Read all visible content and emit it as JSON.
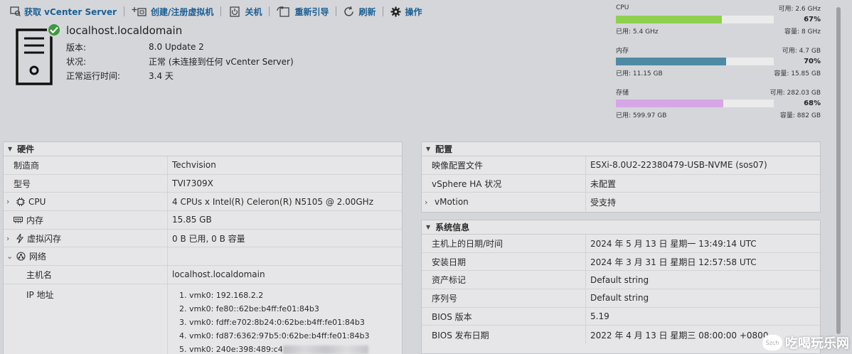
{
  "toolbar": {
    "items": [
      {
        "label": "获取 vCenter Server",
        "icon": "vcenter-icon"
      },
      {
        "label": "创建/注册虚拟机",
        "icon": "create-vm-icon"
      },
      {
        "label": "关机",
        "icon": "power-icon"
      },
      {
        "label": "重新引导",
        "icon": "reboot-icon"
      },
      {
        "label": "刷新",
        "icon": "refresh-icon"
      },
      {
        "label": "操作",
        "icon": "gear-icon"
      }
    ]
  },
  "host": {
    "name": "localhost.localdomain",
    "rows": [
      {
        "key": "版本:",
        "value": "8.0 Update 2"
      },
      {
        "key": "状况:",
        "value": "正常 (未连接到任何 vCenter Server)"
      },
      {
        "key": "正常运行时间:",
        "value": "3.4 天"
      }
    ]
  },
  "meters": [
    {
      "name": "CPU",
      "free": "可用: 2.6 GHz",
      "percent": "67%",
      "fraction": 0.67,
      "used": "已用: 5.4 GHz",
      "capacity": "容量: 8 GHz",
      "color": "#8fd14f"
    },
    {
      "name": "内存",
      "free": "可用: 4.7 GB",
      "percent": "70%",
      "fraction": 0.7,
      "used": "已用: 11.15 GB",
      "capacity": "容量: 15.85 GB",
      "color": "#4f8aa5"
    },
    {
      "name": "存储",
      "free": "可用: 282.03 GB",
      "percent": "68%",
      "fraction": 0.68,
      "used": "已用: 599.97 GB",
      "capacity": "容量: 882 GB",
      "color": "#d7a6e6"
    }
  ],
  "hardware": {
    "title": "硬件",
    "rows": [
      {
        "key": "制造商",
        "value": "Techvision"
      },
      {
        "key": "型号",
        "value": "TVI7309X"
      },
      {
        "key": "CPU",
        "value": "4 CPUs x Intel(R) Celeron(R) N5105 @ 2.00GHz"
      },
      {
        "key": "内存",
        "value": "15.85 GB"
      },
      {
        "key": "虚拟闪存",
        "value": "0 B 已用, 0 B 容量"
      },
      {
        "key": "网络",
        "value": ""
      },
      {
        "key": "主机名",
        "value": "localhost.localdomain"
      },
      {
        "key": "IP 地址",
        "value": ""
      }
    ],
    "ips": [
      "1. vmk0: 192.168.2.2",
      "2. vmk0: fe80::62be:b4ff:fe01:84b3",
      "3. vmk0: fdff:e702:8b24:0:62be:b4ff:fe01:84b3",
      "4. vmk0: fd87:6362:97b5:0:62be:b4ff:fe01:84b3",
      "5. vmk0: 240e:398:489:c4"
    ]
  },
  "config": {
    "title": "配置",
    "rows": [
      {
        "key": "映像配置文件",
        "value": "ESXi-8.0U2-22380479-USB-NVME (sos07)"
      },
      {
        "key": "vSphere HA 状况",
        "value": "未配置"
      },
      {
        "key": "vMotion",
        "value": "受支持"
      }
    ]
  },
  "sysinfo": {
    "title": "系统信息",
    "rows": [
      {
        "key": "主机上的日期/时间",
        "value": "2024 年 5 月 13 日 星期一 13:49:14 UTC"
      },
      {
        "key": "安装日期",
        "value": "2024 年 3 月 31 日 星期日 12:57:58 UTC"
      },
      {
        "key": "资产标记",
        "value": "Default string"
      },
      {
        "key": "序列号",
        "value": "Default string"
      },
      {
        "key": "BIOS 版本",
        "value": "5.19"
      },
      {
        "key": "BIOS 发布日期",
        "value": "2022 年 4 月 13 日 星期三 08:00:00 +0800"
      }
    ]
  },
  "watermark": {
    "badge": "Szch",
    "text": "吃喝玩乐网"
  }
}
